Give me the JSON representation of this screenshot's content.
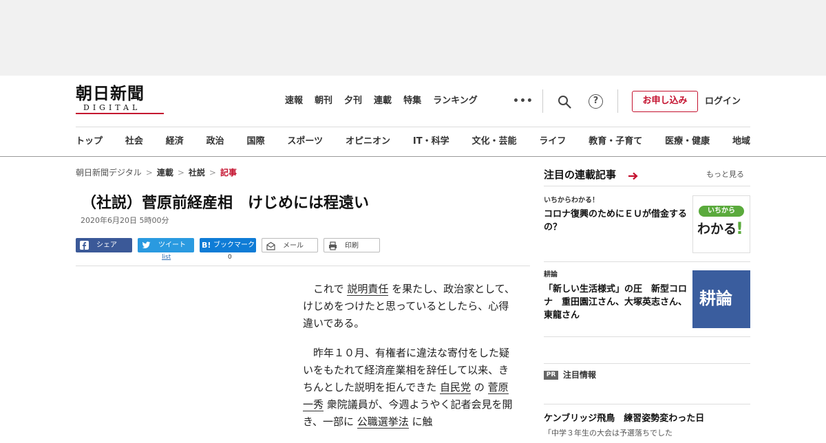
{
  "header": {
    "logo_kanji": "朝日新聞",
    "logo_sub": "DIGITAL",
    "top_nav": [
      "速報",
      "朝刊",
      "夕刊",
      "連載",
      "特集",
      "ランキング"
    ],
    "more": "•••",
    "help": "?",
    "subscribe": "お申し込み",
    "login": "ログイン",
    "categories": [
      "トップ",
      "社会",
      "経済",
      "政治",
      "国際",
      "スポーツ",
      "オピニオン",
      "IT・科学",
      "文化・芸能",
      "ライフ",
      "教育・子育て",
      "医療・健康",
      "地域"
    ]
  },
  "breadcrumb": {
    "items": [
      "朝日新聞デジタル",
      "連載",
      "社説",
      "記事"
    ],
    "sep": ">"
  },
  "article": {
    "title": "（社説）菅原前経産相　けじめには程遠い",
    "date": "2020年6月20日 5時00分",
    "share": {
      "facebook": "シェア",
      "twitter": "ツイート",
      "hatena_icon": "B!",
      "hatena": "ブックマーク",
      "mail": "メール",
      "print": "印刷",
      "twitter_count": "list",
      "hatena_count": "0"
    },
    "p1": {
      "a": "これで ",
      "b": "説明責任",
      "c": " を果たし、政治家として、けじめをつけたと思っているとしたら、心得違いである。"
    },
    "p2": {
      "a": "昨年１０月、有権者に違法な寄付をした疑いをもたれて経済産業相を辞任して以来、きちんとした説明を拒んできた ",
      "b": "自民党",
      "c": " の ",
      "d": "菅原一秀",
      "e": " 衆院議員が、今週ようやく記者会見を開き、一部に ",
      "f": "公職選挙法",
      "g": " に触"
    }
  },
  "sidebar": {
    "heading": "注目の連載記事",
    "more": "もっと見る",
    "cards": [
      {
        "kicker": "いちからわかる！",
        "title": "コロナ復興のためにＥＵが借金するの？",
        "thumb_top": "いちから",
        "thumb_main": "わかる",
        "thumb_mark": "!"
      },
      {
        "kicker": "耕論",
        "title": "「新しい生活様式」の圧　新型コロナ　重田園江さん、大塚英志さん、東龍さん",
        "thumb_text": "耕論"
      }
    ],
    "pr_badge": "PR",
    "pr_label": "注目情報",
    "bottom_title": "ケンブリッジ飛鳥　練習姿勢変わった日",
    "bottom_sub": "「中学３年生の大会は予選落ちでした"
  }
}
